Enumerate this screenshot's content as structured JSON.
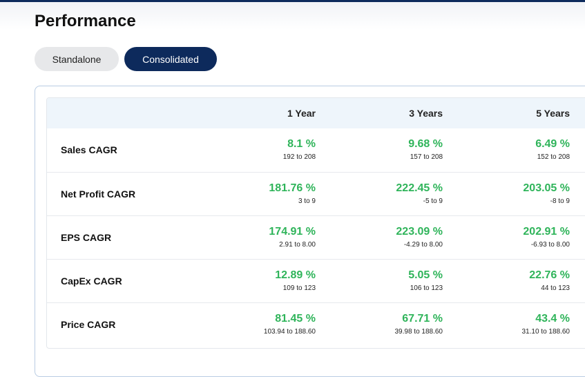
{
  "title": "Performance",
  "toggles": {
    "standalone": "Standalone",
    "consolidated": "Consolidated",
    "active": "Consolidated"
  },
  "colors": {
    "accent_navy": "#0d2a5c",
    "positive_green": "#2fb45a"
  },
  "table": {
    "headers": [
      "",
      "1 Year",
      "3 Years",
      "5 Years"
    ],
    "rows": [
      {
        "label": "Sales CAGR",
        "cells": [
          {
            "pct": "8.1 %",
            "range": "192 to 208"
          },
          {
            "pct": "9.68 %",
            "range": "157 to 208"
          },
          {
            "pct": "6.49 %",
            "range": "152 to 208"
          }
        ]
      },
      {
        "label": "Net Profit CAGR",
        "cells": [
          {
            "pct": "181.76 %",
            "range": "3 to 9"
          },
          {
            "pct": "222.45 %",
            "range": "-5 to 9"
          },
          {
            "pct": "203.05 %",
            "range": "-8 to 9"
          }
        ]
      },
      {
        "label": "EPS CAGR",
        "cells": [
          {
            "pct": "174.91 %",
            "range": "2.91 to 8.00"
          },
          {
            "pct": "223.09 %",
            "range": "-4.29 to 8.00"
          },
          {
            "pct": "202.91 %",
            "range": "-6.93 to 8.00"
          }
        ]
      },
      {
        "label": "CapEx CAGR",
        "cells": [
          {
            "pct": "12.89 %",
            "range": "109 to 123"
          },
          {
            "pct": "5.05 %",
            "range": "106 to 123"
          },
          {
            "pct": "22.76 %",
            "range": "44 to 123"
          }
        ]
      },
      {
        "label": "Price CAGR",
        "cells": [
          {
            "pct": "81.45 %",
            "range": "103.94 to 188.60"
          },
          {
            "pct": "67.71 %",
            "range": "39.98 to 188.60"
          },
          {
            "pct": "43.4 %",
            "range": "31.10 to 188.60"
          }
        ]
      }
    ]
  }
}
